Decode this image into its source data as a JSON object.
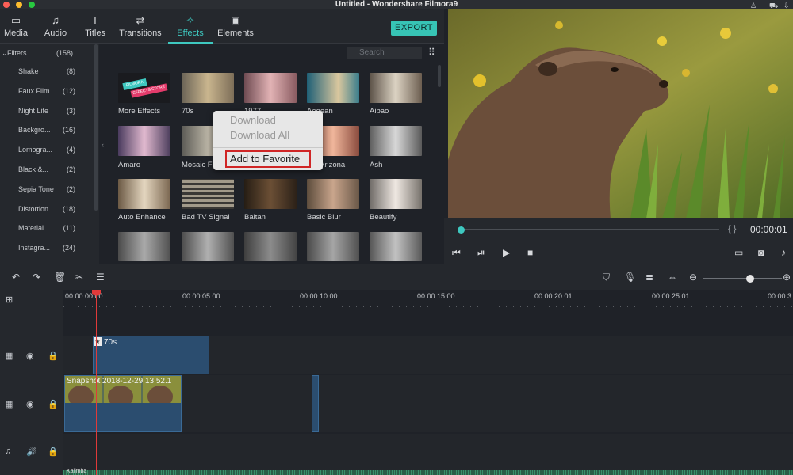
{
  "window": {
    "title": "Untitled - Wondershare Filmora9"
  },
  "nav": {
    "tabs": [
      {
        "label": "Media",
        "icon": "media-icon"
      },
      {
        "label": "Audio",
        "icon": "music-note-icon"
      },
      {
        "label": "Titles",
        "icon": "titles-icon"
      },
      {
        "label": "Transitions",
        "icon": "transitions-icon"
      },
      {
        "label": "Effects",
        "icon": "effects-icon",
        "active": true
      },
      {
        "label": "Elements",
        "icon": "elements-icon"
      }
    ],
    "export_label": "EXPORT"
  },
  "filters": {
    "header": {
      "label": "Filters",
      "count": "(158)"
    },
    "items": [
      {
        "label": "Shake",
        "count": "(8)"
      },
      {
        "label": "Faux Film",
        "count": "(12)"
      },
      {
        "label": "Night Life",
        "count": "(3)"
      },
      {
        "label": "Backgro...",
        "count": "(16)"
      },
      {
        "label": "Lomogra...",
        "count": "(4)"
      },
      {
        "label": "Black &...",
        "count": "(2)"
      },
      {
        "label": "Sepia Tone",
        "count": "(2)"
      },
      {
        "label": "Distortion",
        "count": "(18)"
      },
      {
        "label": "Material",
        "count": "(11)"
      },
      {
        "label": "Instagra...",
        "count": "(24)"
      }
    ]
  },
  "search": {
    "placeholder": "Search"
  },
  "effects": {
    "row1": [
      "More Effects",
      "70s",
      "1977",
      "Aegean",
      "Aibao"
    ],
    "row2": [
      "Amaro",
      "Mosaic F",
      "",
      "Arizona",
      "Ash"
    ],
    "row3": [
      "Auto Enhance",
      "Bad TV Signal",
      "Baltan",
      "Basic Blur",
      "Beautify"
    ],
    "row4": [
      "",
      "",
      "",
      "",
      ""
    ],
    "store_badge_line1": "FILMORA",
    "store_badge_line2": "EFFECTS STORE"
  },
  "context_menu": {
    "items": [
      "Download",
      "Download All"
    ],
    "favorite": "Add to Favorite"
  },
  "player": {
    "timecode": "00:00:01",
    "braces": "{  }"
  },
  "timeline": {
    "ticks": [
      "00:00:00:00",
      "00:00:05:00",
      "00:00:10:00",
      "00:00:15:00",
      "00:00:20:01",
      "00:00:25:01",
      "00:00:3"
    ],
    "effect_clip": "70s",
    "video_clip": "Snapshot 2018-12-29 13.52.1",
    "audio_clip": "Kalimba",
    "zoom_level": 0.6
  },
  "colors": {
    "accent": "#3ec8c0",
    "playhead": "#e03a3a",
    "clip": "#2b4d6f",
    "highlight_border": "#d02626"
  }
}
